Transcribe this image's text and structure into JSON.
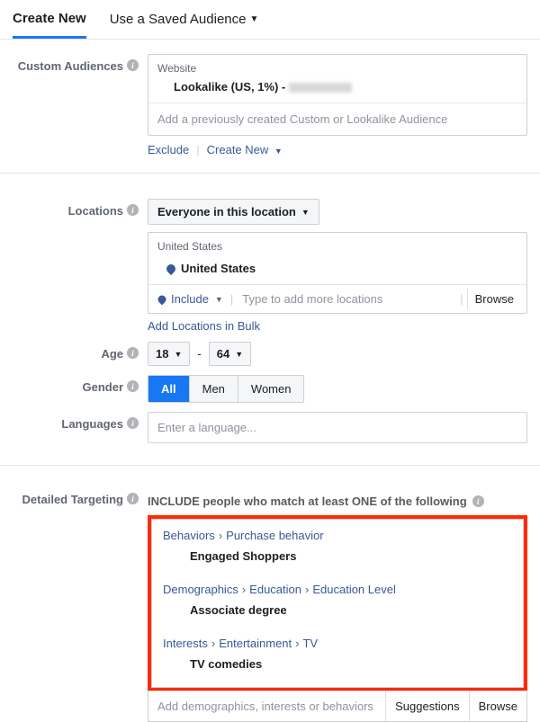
{
  "tabs": {
    "create_new": "Create New",
    "saved": "Use a Saved Audience"
  },
  "custom_audiences": {
    "label": "Custom Audiences",
    "group_label": "Website",
    "item_prefix": "Lookalike (US, 1%) - ",
    "placeholder": "Add a previously created Custom or Lookalike Audience",
    "exclude": "Exclude",
    "create_new": "Create New"
  },
  "locations": {
    "label": "Locations",
    "scope": "Everyone in this location",
    "group": "United States",
    "item": "United States",
    "include": "Include",
    "placeholder": "Type to add more locations",
    "browse": "Browse",
    "bulk_link": "Add Locations in Bulk"
  },
  "age": {
    "label": "Age",
    "min": "18",
    "max": "64"
  },
  "gender": {
    "label": "Gender",
    "all": "All",
    "men": "Men",
    "women": "Women"
  },
  "languages": {
    "label": "Languages",
    "placeholder": "Enter a language..."
  },
  "detailed_targeting": {
    "label": "Detailed Targeting",
    "heading": "INCLUDE people who match at least ONE of the following",
    "items": [
      {
        "path": [
          "Behaviors",
          "Purchase behavior"
        ],
        "value": "Engaged Shoppers"
      },
      {
        "path": [
          "Demographics",
          "Education",
          "Education Level"
        ],
        "value": "Associate degree"
      },
      {
        "path": [
          "Interests",
          "Entertainment",
          "TV"
        ],
        "value": "TV comedies"
      }
    ],
    "placeholder": "Add demographics, interests or behaviors",
    "suggestions": "Suggestions",
    "browse": "Browse"
  }
}
